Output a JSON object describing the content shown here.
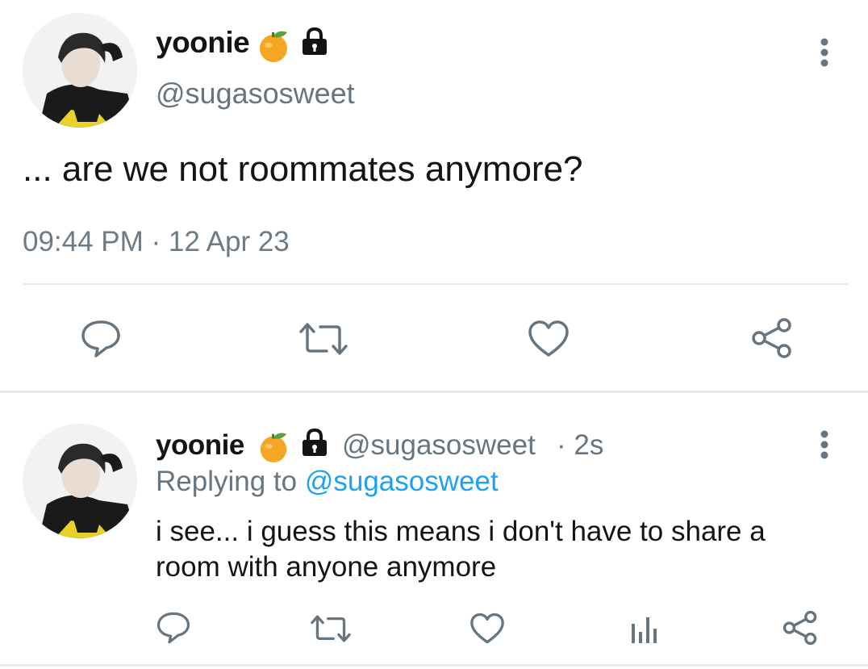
{
  "main_tweet": {
    "display_name": "yoonie",
    "handle": "@sugasosweet",
    "text": "... are we not roommates anymore?",
    "timestamp": "09:44 PM · 12 Apr 23",
    "badges": [
      "tangerine-emoji",
      "lock-icon"
    ],
    "actions": [
      "reply-icon",
      "retweet-icon",
      "like-icon",
      "share-icon"
    ]
  },
  "reply_tweet": {
    "display_name": "yoonie",
    "handle": "@sugasosweet",
    "time_ago": "· 2s",
    "replying_prefix": "Replying to",
    "replying_handle": "@sugasosweet",
    "text_line1": "i see... i guess this means i don't have to share a",
    "text_line2": "room with anyone anymore",
    "badges": [
      "tangerine-emoji",
      "lock-icon"
    ],
    "actions": [
      "reply-icon",
      "retweet-icon",
      "like-icon",
      "analytics-icon",
      "share-icon"
    ]
  },
  "colors": {
    "icon_gray": "#66757f",
    "link_blue": "#1da1f2",
    "divider": "#e6ecf0"
  }
}
